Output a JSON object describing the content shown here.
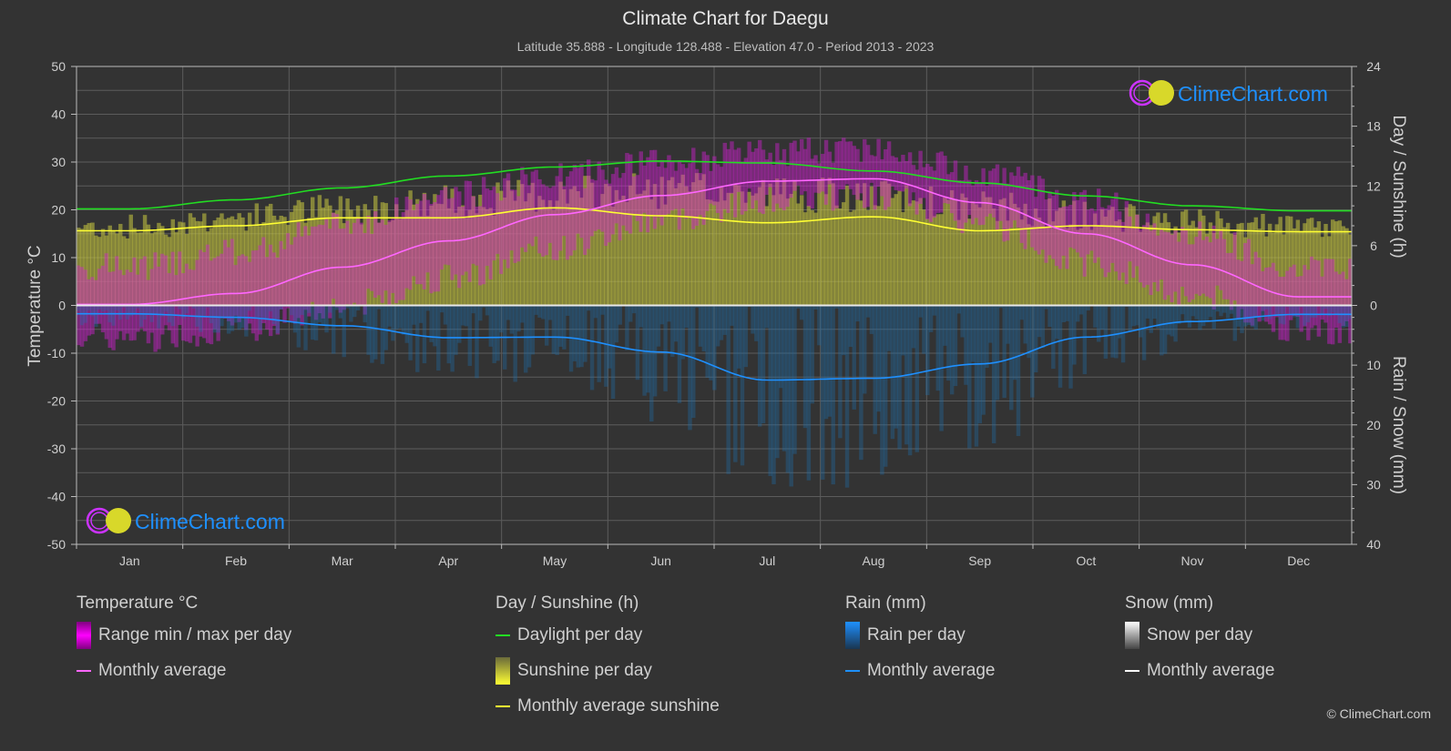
{
  "header": {
    "title": "Climate Chart for Daegu",
    "subtitle": "Latitude 35.888 - Longitude 128.488 - Elevation 47.0 - Period 2013 - 2023"
  },
  "watermark": {
    "text": "ClimeChart.com"
  },
  "copyright": "© ClimeChart.com",
  "colors": {
    "background": "#333333",
    "temperature_range": "#e000e0",
    "temperature_avg": "#ff66ff",
    "daylight": "#22dd22",
    "sunshine_fill": "#d4d43a",
    "sunshine_avg": "#ffff33",
    "rain": "#1e8fe8",
    "rain_avg": "#1e90ff",
    "snow": "#ffffff",
    "snow_avg": "#ffffff",
    "brand_blue": "#1e90ff"
  },
  "legend": {
    "groups": [
      {
        "title": "Temperature °C",
        "items": [
          {
            "label": "Range min / max per day",
            "type": "bar",
            "key": "temperature_range"
          },
          {
            "label": "Monthly average",
            "type": "line",
            "key": "temperature_avg"
          }
        ]
      },
      {
        "title": "Day / Sunshine (h)",
        "items": [
          {
            "label": "Daylight per day",
            "type": "line",
            "key": "daylight"
          },
          {
            "label": "Sunshine per day",
            "type": "bar",
            "key": "sunshine_fill"
          },
          {
            "label": "Monthly average sunshine",
            "type": "line",
            "key": "sunshine_avg"
          }
        ]
      },
      {
        "title": "Rain (mm)",
        "items": [
          {
            "label": "Rain per day",
            "type": "bar",
            "key": "rain"
          },
          {
            "label": "Monthly average",
            "type": "line",
            "key": "rain_avg"
          }
        ]
      },
      {
        "title": "Snow (mm)",
        "items": [
          {
            "label": "Snow per day",
            "type": "bar",
            "key": "snow"
          },
          {
            "label": "Monthly average",
            "type": "line",
            "key": "snow_avg"
          }
        ]
      }
    ]
  },
  "chart_data": {
    "type": "line",
    "title": "Climate Chart for Daegu",
    "categories": [
      "Jan",
      "Feb",
      "Mar",
      "Apr",
      "May",
      "Jun",
      "Jul",
      "Aug",
      "Sep",
      "Oct",
      "Nov",
      "Dec"
    ],
    "axes": {
      "left": {
        "label": "Temperature °C",
        "range": [
          -50,
          50
        ],
        "ticks": [
          50,
          40,
          30,
          20,
          10,
          0,
          -10,
          -20,
          -30,
          -40,
          -50
        ]
      },
      "right_top": {
        "label": "Day / Sunshine (h)",
        "range": [
          0,
          24
        ],
        "ticks": [
          24,
          18,
          12,
          6,
          0
        ]
      },
      "right_bottom": {
        "label": "Rain / Snow (mm)",
        "range": [
          0,
          40
        ],
        "ticks": [
          10,
          20,
          30,
          40
        ],
        "inverted": true
      }
    },
    "grid": true,
    "series": [
      {
        "name": "Temperature monthly average",
        "unit": "°C",
        "axis": "left",
        "values": [
          0.2,
          2.5,
          8.0,
          13.5,
          19.0,
          23.0,
          26.0,
          26.5,
          21.5,
          15.0,
          8.5,
          1.8
        ]
      },
      {
        "name": "Temperature daily max (approx. envelope)",
        "unit": "°C",
        "axis": "left",
        "values": [
          8,
          11,
          17,
          23,
          27,
          30,
          32,
          33,
          28,
          22,
          15,
          8
        ]
      },
      {
        "name": "Temperature daily min (approx. envelope)",
        "unit": "°C",
        "axis": "left",
        "values": [
          -7,
          -5,
          0,
          6,
          12,
          18,
          22,
          23,
          17,
          9,
          2,
          -5
        ]
      },
      {
        "name": "Daylight per day",
        "unit": "h",
        "axis": "right_top",
        "values": [
          9.7,
          10.6,
          11.8,
          13.0,
          13.9,
          14.5,
          14.3,
          13.5,
          12.3,
          11.0,
          10.0,
          9.5
        ]
      },
      {
        "name": "Sunshine per day (approx. envelope)",
        "unit": "h",
        "axis": "right_top",
        "values": [
          8.8,
          9.8,
          10.8,
          11.6,
          12.4,
          12.8,
          12.6,
          12.0,
          11.0,
          10.0,
          9.2,
          8.6
        ]
      },
      {
        "name": "Monthly average sunshine",
        "unit": "h",
        "axis": "right_top",
        "values": [
          7.5,
          8.0,
          8.8,
          8.8,
          9.8,
          9.0,
          8.3,
          8.9,
          7.5,
          8.0,
          7.6,
          7.4
        ]
      },
      {
        "name": "Rain monthly average",
        "unit": "mm",
        "axis": "right_bottom",
        "values": [
          1.4,
          2.0,
          3.4,
          5.4,
          5.3,
          7.8,
          12.5,
          12.2,
          9.8,
          5.3,
          2.7,
          1.5
        ]
      },
      {
        "name": "Snow monthly average",
        "unit": "mm",
        "axis": "right_bottom",
        "values": [
          0,
          0,
          0,
          0,
          0,
          0,
          0,
          0,
          0,
          0,
          0,
          0
        ]
      }
    ]
  }
}
